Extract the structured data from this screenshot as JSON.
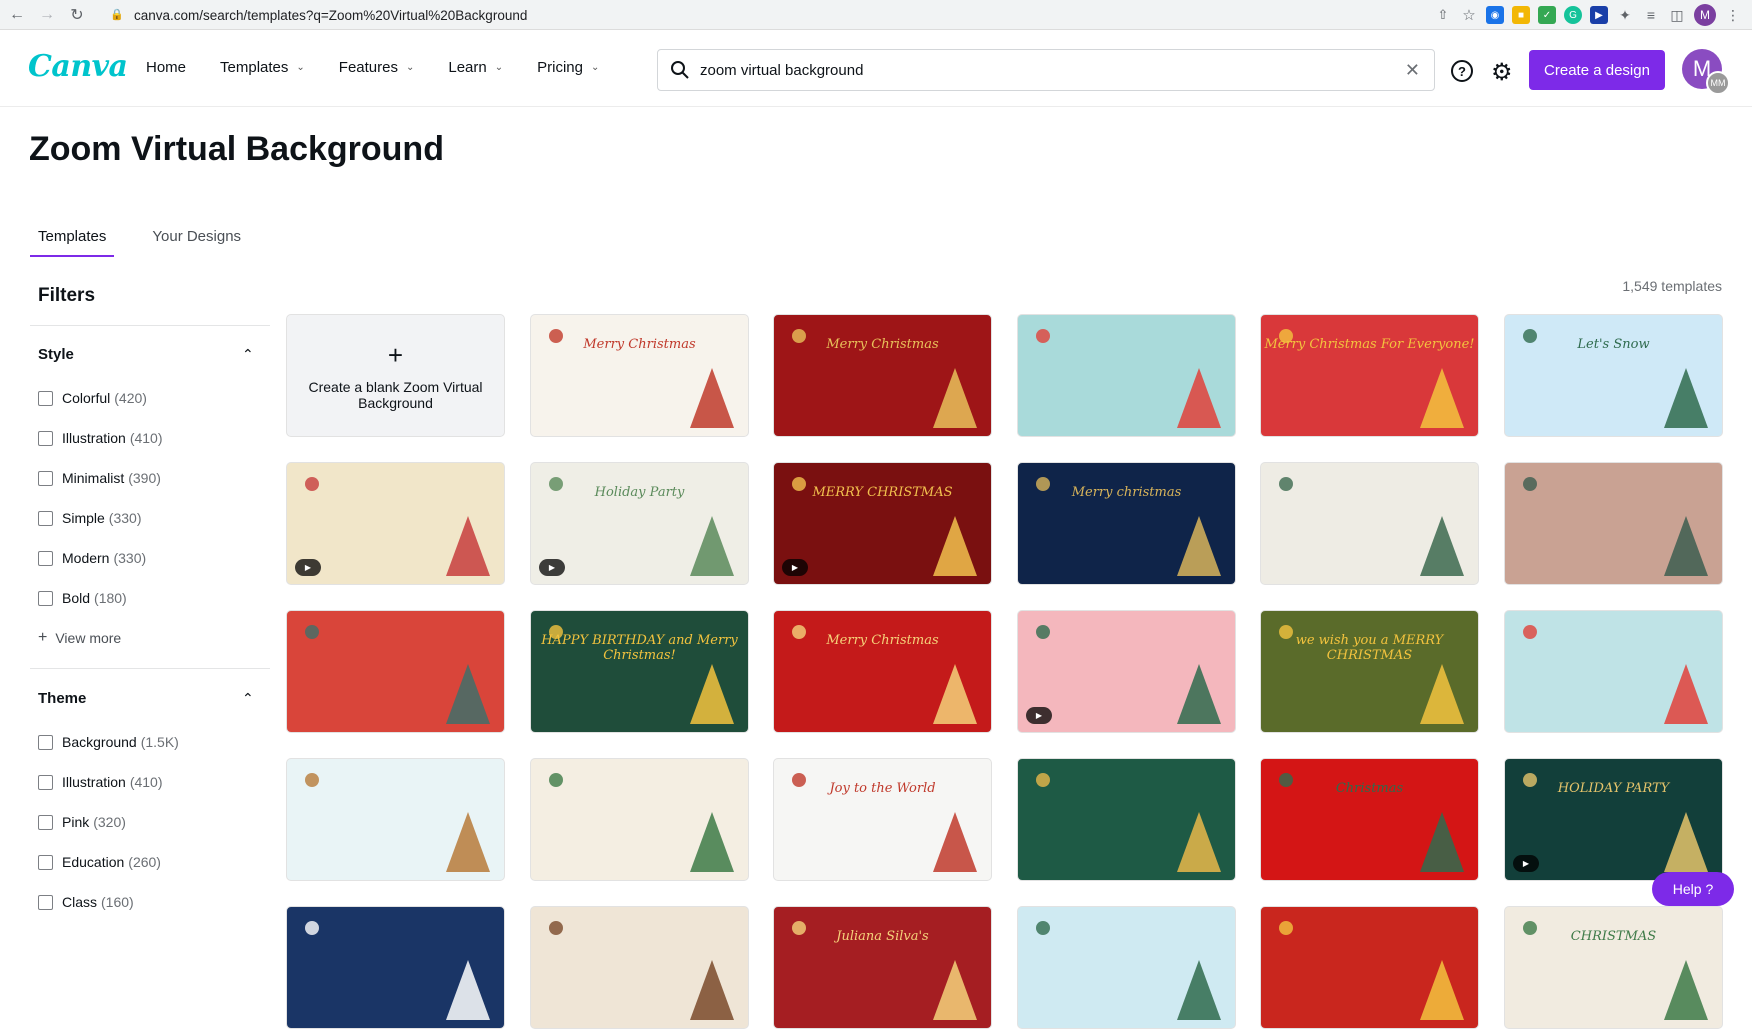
{
  "browser": {
    "url": "canva.com/search/templates?q=Zoom%20Virtual%20Background",
    "profile_initial": "M"
  },
  "header": {
    "logo": "Canva",
    "nav": [
      {
        "label": "Home",
        "has_dropdown": false
      },
      {
        "label": "Templates",
        "has_dropdown": true
      },
      {
        "label": "Features",
        "has_dropdown": true
      },
      {
        "label": "Learn",
        "has_dropdown": true
      },
      {
        "label": "Pricing",
        "has_dropdown": true
      }
    ],
    "search_value": "zoom virtual background",
    "create_label": "Create a design",
    "avatar_initial": "M",
    "avatar_sub": "MM"
  },
  "page": {
    "title": "Zoom Virtual Background",
    "tabs": [
      "Templates",
      "Your Designs"
    ],
    "template_count": "1,549 templates"
  },
  "filters": {
    "title": "Filters",
    "style": {
      "title": "Style",
      "options": [
        {
          "label": "Colorful",
          "count": "(420)"
        },
        {
          "label": "Illustration",
          "count": "(410)"
        },
        {
          "label": "Minimalist",
          "count": "(390)"
        },
        {
          "label": "Simple",
          "count": "(330)"
        },
        {
          "label": "Modern",
          "count": "(330)"
        },
        {
          "label": "Bold",
          "count": "(180)"
        }
      ],
      "view_more": "View more"
    },
    "theme": {
      "title": "Theme",
      "options": [
        {
          "label": "Background",
          "count": "(1.5K)"
        },
        {
          "label": "Illustration",
          "count": "(410)"
        },
        {
          "label": "Pink",
          "count": "(320)"
        },
        {
          "label": "Education",
          "count": "(260)"
        },
        {
          "label": "Class",
          "count": "(160)"
        }
      ]
    }
  },
  "grid": {
    "blank_card_label": "Create a blank Zoom Virtual Background",
    "cards": [
      {
        "name": "merry-christmas-holly-border",
        "bg": "#f7f3ec",
        "accent": "#c0392b",
        "caption": "Merry Christmas",
        "video": false
      },
      {
        "name": "merry-christmas-red-gold",
        "bg": "#9e1517",
        "accent": "#e8c15a",
        "caption": "Merry Christmas",
        "video": false
      },
      {
        "name": "elves-teal",
        "bg": "#a9dada",
        "accent": "#e0413a",
        "caption": "",
        "video": false
      },
      {
        "name": "merry-christmas-for-everyone",
        "bg": "#d9383a",
        "accent": "#f3c33e",
        "caption": "Merry Christmas For Everyone!",
        "video": false
      },
      {
        "name": "lets-snow",
        "bg": "#cfe9f7",
        "accent": "#2f6b4e",
        "caption": "Let's Snow",
        "video": false
      },
      {
        "name": "patchwork-pattern",
        "bg": "#f1e6c9",
        "accent": "#c73d3d",
        "caption": "",
        "video": true
      },
      {
        "name": "holiday-party-tree",
        "bg": "#efeee6",
        "accent": "#5a8a5a",
        "caption": "Holiday Party",
        "video": true
      },
      {
        "name": "merry-christmas-dark-red",
        "bg": "#7a1010",
        "accent": "#f2c14e",
        "caption": "MERRY CHRISTMAS",
        "video": true
      },
      {
        "name": "navy-ornaments",
        "bg": "#0f2449",
        "accent": "#d8b45a",
        "caption": "Merry christmas",
        "video": false
      },
      {
        "name": "beige-cards",
        "bg": "#eeece4",
        "accent": "#3c6a4f",
        "caption": "",
        "video": false
      },
      {
        "name": "fireplace-room",
        "bg": "#c9a293",
        "accent": "#3d5e50",
        "caption": "",
        "video": false
      },
      {
        "name": "red-living-room",
        "bg": "#d9453a",
        "accent": "#3f6f6a",
        "caption": "",
        "video": false
      },
      {
        "name": "happy-birthday-merry-christmas",
        "bg": "#1f4d3a",
        "accent": "#f3c33e",
        "caption": "HAPPY BIRTHDAY and Merry Christmas!",
        "video": false
      },
      {
        "name": "red-gradient-merry-christmas",
        "bg": "#c41a1a",
        "accent": "#f5d27a",
        "caption": "Merry Christmas",
        "video": false
      },
      {
        "name": "pink-pattern",
        "bg": "#f4b7bd",
        "accent": "#2f6b4e",
        "caption": "",
        "video": true
      },
      {
        "name": "we-wish-you-merry-christmas",
        "bg": "#5a6b2a",
        "accent": "#f3c33e",
        "caption": "we wish you a MERRY CHRISTMAS",
        "video": false
      },
      {
        "name": "fireplace-teal",
        "bg": "#bfe3e6",
        "accent": "#e0413a",
        "caption": "",
        "video": false
      },
      {
        "name": "reindeer-window",
        "bg": "#e9f4f6",
        "accent": "#b77a3a",
        "caption": "",
        "video": false
      },
      {
        "name": "reindeer-trees",
        "bg": "#f4eee2",
        "accent": "#3d7a47",
        "caption": "",
        "video": false
      },
      {
        "name": "joy-to-the-world",
        "bg": "#f6f6f4",
        "accent": "#c0392b",
        "caption": "Joy to the World",
        "video": false
      },
      {
        "name": "green-folk-pattern",
        "bg": "#1e5a45",
        "accent": "#e9b84a",
        "caption": "",
        "video": false
      },
      {
        "name": "red-trees",
        "bg": "#d41515",
        "accent": "#2f6b4e",
        "caption": "Christmas",
        "video": false
      },
      {
        "name": "holiday-party-fireworks",
        "bg": "#123f3a",
        "accent": "#e5c46b",
        "caption": "HOLIDAY PARTY",
        "video": true
      },
      {
        "name": "navy-snowflakes",
        "bg": "#1a3566",
        "accent": "#ffffff",
        "caption": "",
        "video": false
      },
      {
        "name": "cream-pine",
        "bg": "#efe5d6",
        "accent": "#7a4a2a",
        "caption": "",
        "video": false
      },
      {
        "name": "red-banner",
        "bg": "#a51e22",
        "accent": "#f5d27a",
        "caption": "Juliana Silva's",
        "video": false
      },
      {
        "name": "light-blue",
        "bg": "#cfeaf2",
        "accent": "#2f6b4e",
        "caption": "",
        "video": false
      },
      {
        "name": "red-script",
        "bg": "#c9261e",
        "accent": "#f3c33e",
        "caption": "",
        "video": false
      },
      {
        "name": "cream-christmas",
        "bg": "#f1ebe0",
        "accent": "#3d7a47",
        "caption": "CHRISTMAS",
        "video": false
      }
    ]
  },
  "help": {
    "label": "Help  ?"
  }
}
